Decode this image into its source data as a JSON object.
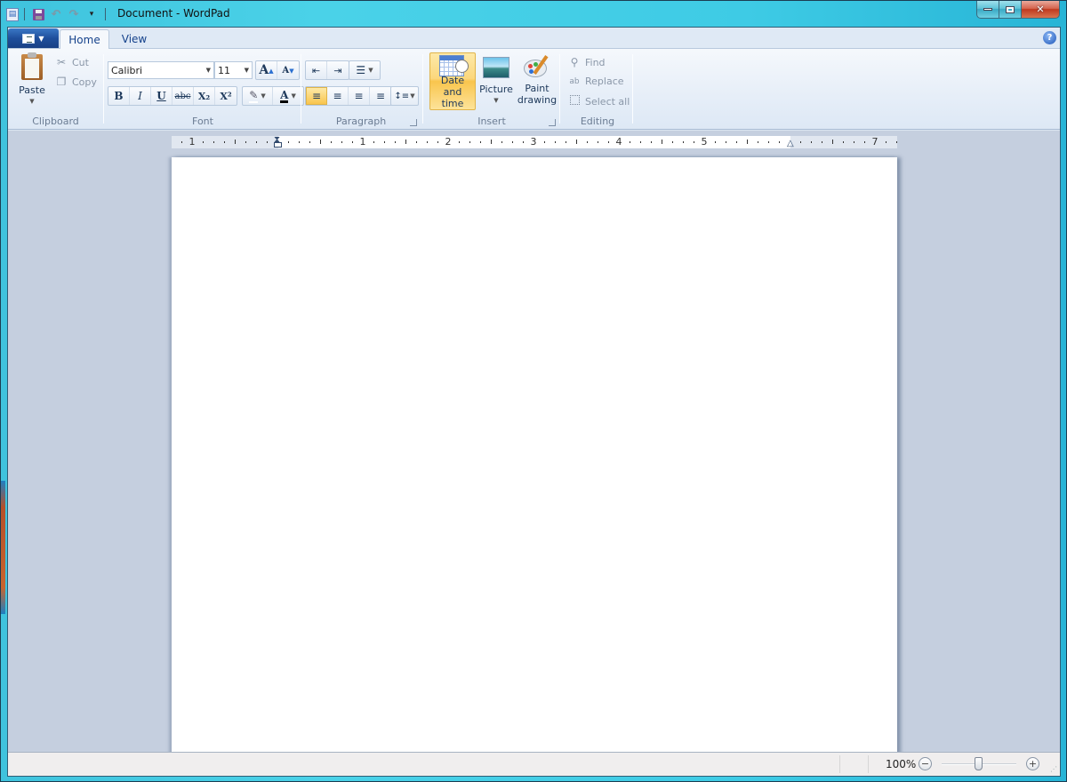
{
  "window": {
    "title": "Document - WordPad",
    "controls": {
      "minimize": "—",
      "maximize": "□",
      "close": "✕"
    }
  },
  "quick_access": [
    {
      "name": "app-icon",
      "glyph": "▤"
    },
    {
      "name": "save-icon",
      "glyph": "💾"
    },
    {
      "name": "undo-icon",
      "glyph": "↶"
    },
    {
      "name": "redo-icon",
      "glyph": "↷"
    },
    {
      "name": "customize-qat-icon",
      "glyph": "▾"
    }
  ],
  "tabs": [
    {
      "label": "Home",
      "active": true
    },
    {
      "label": "View",
      "active": false
    }
  ],
  "help_glyph": "?",
  "ribbon": {
    "clipboard": {
      "label": "Clipboard",
      "paste": "Paste",
      "cut": "Cut",
      "copy": "Copy"
    },
    "font": {
      "label": "Font",
      "family": "Calibri",
      "size": "11",
      "grow_glyph": "A",
      "shrink_glyph": "A",
      "bold": "B",
      "italic": "I",
      "underline": "U",
      "strikethrough": "abc",
      "subscript": "X₂",
      "superscript": "X²",
      "highlight_glyph": "✎",
      "color_glyph": "A"
    },
    "paragraph": {
      "label": "Paragraph",
      "decrease_indent": "⇤",
      "increase_indent": "⇥",
      "list": "☰",
      "align_left": "≡",
      "align_center": "≡",
      "align_right": "≡",
      "justify": "≡",
      "line_spacing": "↕≡"
    },
    "insert": {
      "label": "Insert",
      "date_time": [
        "Date and",
        "time"
      ],
      "picture": "Picture",
      "paint": [
        "Paint",
        "drawing"
      ]
    },
    "editing": {
      "label": "Editing",
      "find": "Find",
      "replace": "Replace",
      "select_all": "Select all"
    }
  },
  "ruler": {
    "labels": [
      "1",
      "1",
      "2",
      "3",
      "4",
      "5",
      "7"
    ]
  },
  "status": {
    "zoom_level": "100%",
    "zoom_out": "−",
    "zoom_in": "+",
    "zoom_slider_percent": 50
  }
}
